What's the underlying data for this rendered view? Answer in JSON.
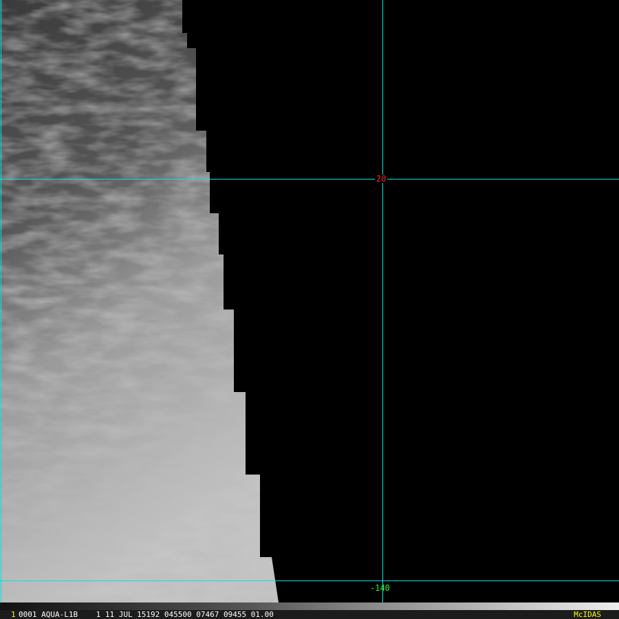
{
  "grid": {
    "lat_label": "20",
    "lon_label": "-140",
    "lat_color": "#ff2020",
    "lon_color": "#20ff20",
    "line_color": "#00e5e5"
  },
  "status": {
    "frame": "1",
    "info": "0001 AQUA-L1B    1 11 JUL 15192 045500 07467 09455 01.00",
    "brand": "McIDAS"
  }
}
